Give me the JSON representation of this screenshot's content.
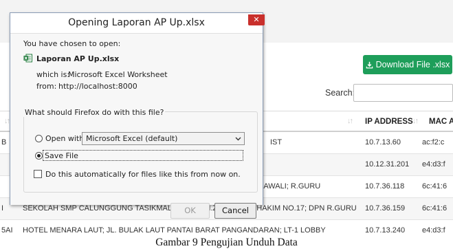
{
  "page": {
    "download_button_label": "Download File .xlsx",
    "search_label": "Search:",
    "search_value": "",
    "headers": {
      "ip": "IP ADDRESS",
      "mac": "MAC A"
    },
    "rows": [
      {
        "prefix": "B",
        "desc": "IST",
        "ip": "10.7.13.60",
        "mac": "ac:f2:c"
      },
      {
        "prefix": "",
        "desc": "",
        "ip": "10.12.31.201",
        "mac": "e4:d3:f"
      },
      {
        "prefix": "",
        "desc": "KAWALI; R.GURU",
        "ip": "10.7.36.118",
        "mac": "6c:41:6"
      },
      {
        "prefix": "I",
        "desc": "SEKOLAH SMP CALUNGGUNG TASIKMALAYA; JL.KH.ZURMANUL HAKIM NO.17; DPN R.GURU",
        "ip": "10.7.36.159",
        "mac": "6c:41:6"
      },
      {
        "prefix": "5AI",
        "desc": "HOTEL MENARA LAUT; JL. BULAK LAUT PANTAI BARAT PANGANDARAN; LT-1 LOBBY",
        "ip": "10.7.13.240",
        "mac": "e4:d3:f"
      }
    ]
  },
  "dialog": {
    "title": "Opening Laporan AP Up.xlsx",
    "close_glyph": "✕",
    "chosen_text": "You have chosen to open:",
    "file_name": "Laporan AP Up.xlsx",
    "which_is_label": "which is:",
    "which_is_value": "Microsoft Excel Worksheet",
    "from_label": "from:",
    "from_value": "http://localhost:8000",
    "question": "What should Firefox do with this file?",
    "open_with_label": "Open with",
    "open_with_app": "Microsoft Excel (default)",
    "save_file_label": "Save File",
    "selected_option": "save",
    "auto_label": "Do this automatically for files like this from now on.",
    "auto_checked": false,
    "ok_label": "OK",
    "cancel_label": "Cancel"
  },
  "caption": "Gambar 9 Pengujian Unduh Data",
  "colors": {
    "download_button": "#1e9e5a",
    "close_button": "#c9302c",
    "excel_icon": "#1f7a3a"
  }
}
